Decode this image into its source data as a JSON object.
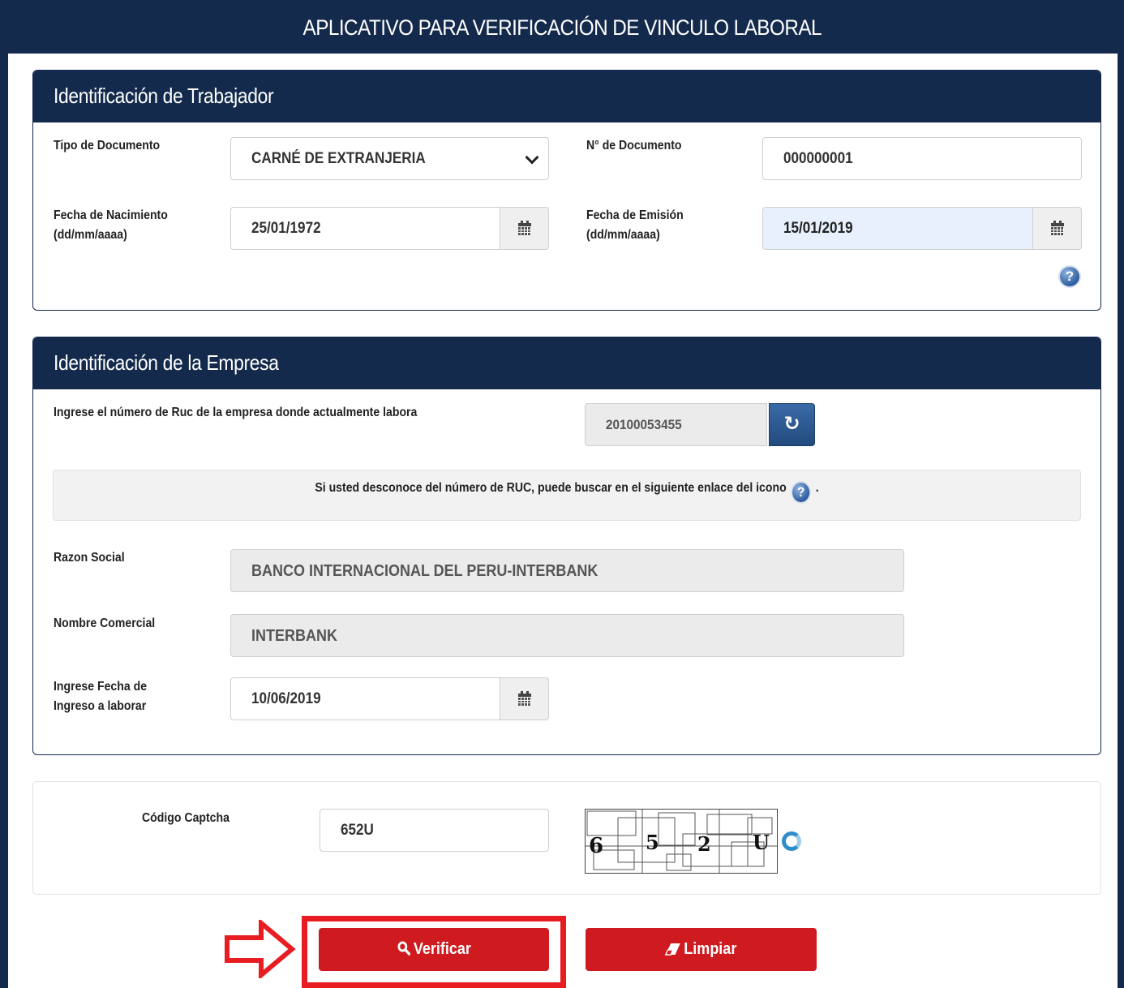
{
  "app": {
    "title": "APLICATIVO PARA VERIFICACIÓN DE VINCULO LABORAL"
  },
  "worker": {
    "header": "Identificación de Trabajador",
    "doc_type_label": "Tipo de Documento",
    "doc_type_value": "CARNÉ DE EXTRANJERIA",
    "doc_number_label": "N° de Documento",
    "doc_number_value": "000000001",
    "birth_label_1": "Fecha de Nacimiento",
    "birth_label_2": "(dd/mm/aaaa)",
    "birth_value": "25/01/1972",
    "emission_label_1": "Fecha de Emisión",
    "emission_label_2": "(dd/mm/aaaa)",
    "emission_value": "15/01/2019"
  },
  "company": {
    "header": "Identificación de la Empresa",
    "ruc_label": "Ingrese el número de Ruc de la empresa donde actualmente labora",
    "ruc_value": "20100053455",
    "info_text": "Si usted desconoce del número de RUC, puede buscar en el siguiente enlace del icono",
    "info_suffix": ".",
    "razon_label": "Razon Social",
    "razon_value": "BANCO INTERNACIONAL DEL PERU-INTERBANK",
    "nombre_label": "Nombre Comercial",
    "nombre_value": "INTERBANK",
    "ingreso_label_1": "Ingrese Fecha de",
    "ingreso_label_2": "Ingreso a laborar",
    "ingreso_value": "10/06/2019"
  },
  "captcha": {
    "label": "Código Captcha",
    "value": "652U",
    "image_chars": [
      "6",
      "5",
      "2",
      "U"
    ]
  },
  "actions": {
    "verify_label": "Verificar",
    "clear_label": "Limpiar"
  },
  "icons": {
    "calendar": "calendar-icon",
    "help": "help-icon",
    "refresh": "refresh-icon",
    "search": "search-icon",
    "eraser": "eraser-icon",
    "arrow": "arrow-right-icon"
  },
  "colors": {
    "header_navy": "#142a4c",
    "button_red": "#cf1a1f",
    "highlight_red": "#e81d22",
    "input_autofill": "#e8f0fe"
  }
}
